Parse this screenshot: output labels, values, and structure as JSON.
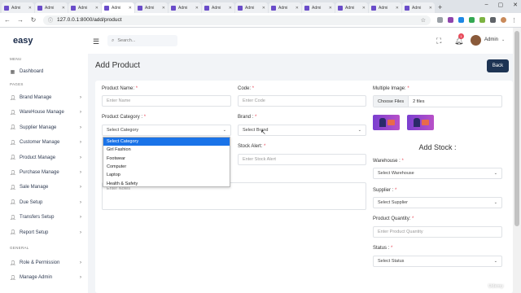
{
  "browser": {
    "tabs": [
      {
        "label": "Admi",
        "active": false
      },
      {
        "label": "Admi",
        "active": false
      },
      {
        "label": "Admi",
        "active": false
      },
      {
        "label": "Admi",
        "active": true
      },
      {
        "label": "Admi",
        "active": false
      },
      {
        "label": "Admi",
        "active": false
      },
      {
        "label": "Admi",
        "active": false
      },
      {
        "label": "Admi",
        "active": false
      },
      {
        "label": "Admi",
        "active": false
      },
      {
        "label": "Admi",
        "active": false
      },
      {
        "label": "Admi",
        "active": false
      },
      {
        "label": "Admi",
        "active": false
      },
      {
        "label": "Admi",
        "active": false
      }
    ],
    "url": "127.0.0.1:8000/add/product"
  },
  "sidebar": {
    "logo": "easy",
    "menu_heading": "MENU",
    "pages_heading": "PAGES",
    "general_heading": "GENERAL",
    "dashboard": "Dashboard",
    "items": [
      {
        "label": "Brand Manage",
        "icon": "user-icon"
      },
      {
        "label": "WareHouse Manage",
        "icon": "user-icon"
      },
      {
        "label": "Supplier Manage",
        "icon": "user-icon"
      },
      {
        "label": "Customer Manage",
        "icon": "user-icon"
      },
      {
        "label": "Product Manage",
        "icon": "user-icon"
      },
      {
        "label": "Purchase Manage",
        "icon": "user-icon"
      },
      {
        "label": "Sale Manage",
        "icon": "user-icon"
      },
      {
        "label": "Due Setup",
        "icon": "user-icon"
      },
      {
        "label": "Transfers Setup",
        "icon": "user-icon"
      },
      {
        "label": "Report Setup",
        "icon": "user-icon"
      }
    ],
    "general_items": [
      {
        "label": "Role & Permission",
        "icon": "user-icon"
      },
      {
        "label": "Manage Admin",
        "icon": "user-icon"
      }
    ]
  },
  "header": {
    "search_placeholder": "Search...",
    "notification_count": "1",
    "user_name": "Admin"
  },
  "page": {
    "title": "Add Product",
    "back_label": "Back"
  },
  "form": {
    "product_name_label": "Product Name:",
    "product_name_placeholder": "Enter Name",
    "code_label": "Code:",
    "code_placeholder": "Enter Code",
    "multiple_image_label": "Multiple Image:",
    "choose_files_label": "Choose Files",
    "files_count": "2 files",
    "category_label": "Product Category :",
    "category_value": "Select Category",
    "brand_label": "Brand :",
    "brand_value": "Select Brand",
    "stock_alert_label": "Stock Alert:",
    "stock_alert_placeholder": "Enter Stock Alert",
    "notes_placeholder": "Enter Notes",
    "add_stock_heading": "Add Stock :",
    "warehouse_label": "Warehouse :",
    "warehouse_value": "Select Warehouse",
    "supplier_label": "Supplier :",
    "supplier_value": "Select Supplier",
    "quantity_label": "Product Quantity:",
    "quantity_placeholder": "Enter Product Quantity",
    "status_label": "Status :",
    "status_value": "Select Status",
    "required_mark": "*"
  },
  "category_dropdown": {
    "options": [
      "Select Category",
      "Girl Fashion",
      "Footwear",
      "Computer",
      "Laptop",
      "Health & Safety"
    ],
    "highlighted_index": 0
  },
  "watermark": "Udemy",
  "colors": {
    "primary_dark": "#1e3454",
    "accent_red": "#e84c5c",
    "highlight_blue": "#1a73e8"
  }
}
